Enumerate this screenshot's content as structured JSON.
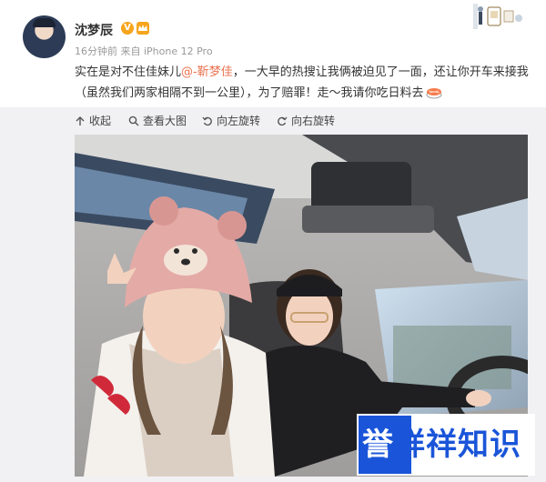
{
  "post": {
    "username": "沈梦辰",
    "verified_badge": "V",
    "meta": "16分钟前 来自 iPhone 12 Pro",
    "text_before": "实在是对不住佳妹儿",
    "mention": "@-靳梦佳",
    "text_after": "，一大早的热搜让我俩被迫见了一面，还让你开车来接我（虽然我们两家相隔不到一公里），为了赔罪！走～我请你吃日料去",
    "emoji_icon": "sushi-icon"
  },
  "toolbar": {
    "collapse": "收起",
    "view_large": "查看大图",
    "rotate_left": "向左旋转",
    "rotate_right": "向右旋转"
  },
  "watermark": {
    "first_char": "誉",
    "rest": "祥祥知识"
  },
  "colors": {
    "mention": "#eb7350",
    "verified": "#f7a51c",
    "watermark_blue": "#1a55d9",
    "toolbar_bg": "#f1f1f3"
  }
}
